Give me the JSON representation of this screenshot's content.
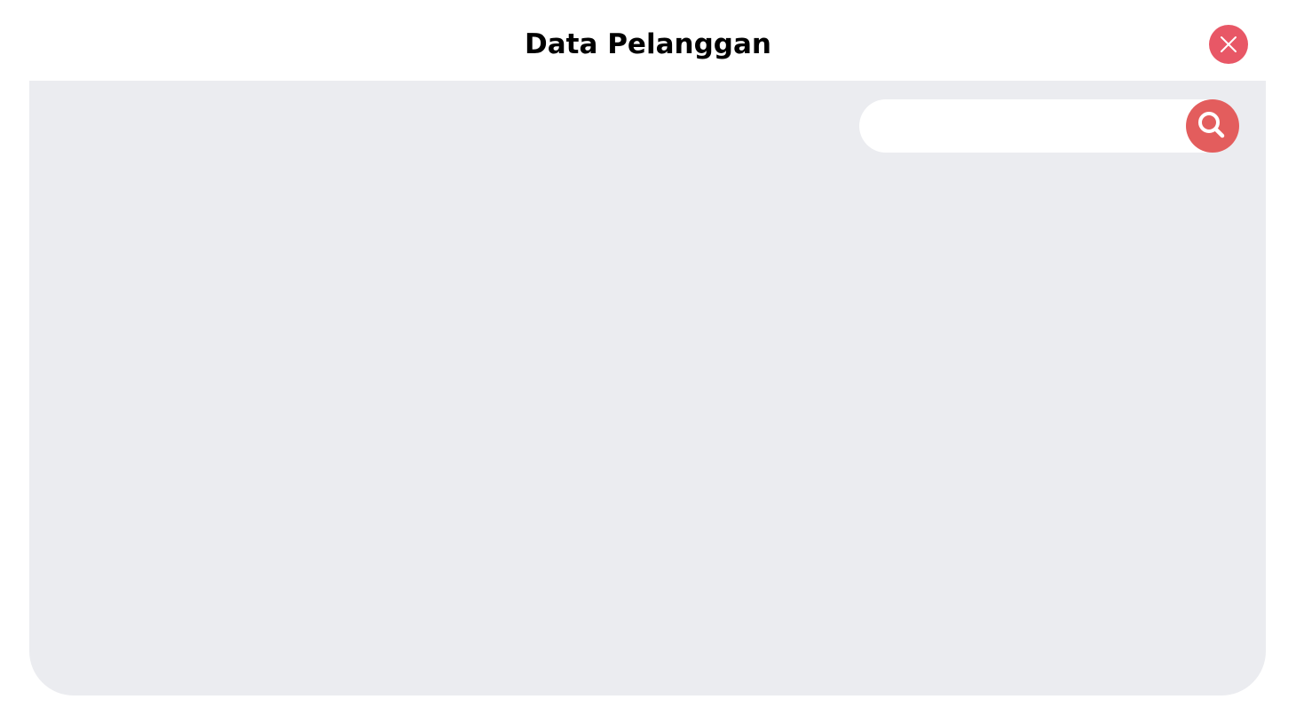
{
  "header": {
    "title": "Data Pelanggan",
    "close_icon": "close-icon"
  },
  "search": {
    "value": "",
    "placeholder": "",
    "icon": "search-icon"
  },
  "colors": {
    "close_button": "#e85766",
    "search_button": "#e35d5d",
    "panel_background": "#ebecf0"
  }
}
